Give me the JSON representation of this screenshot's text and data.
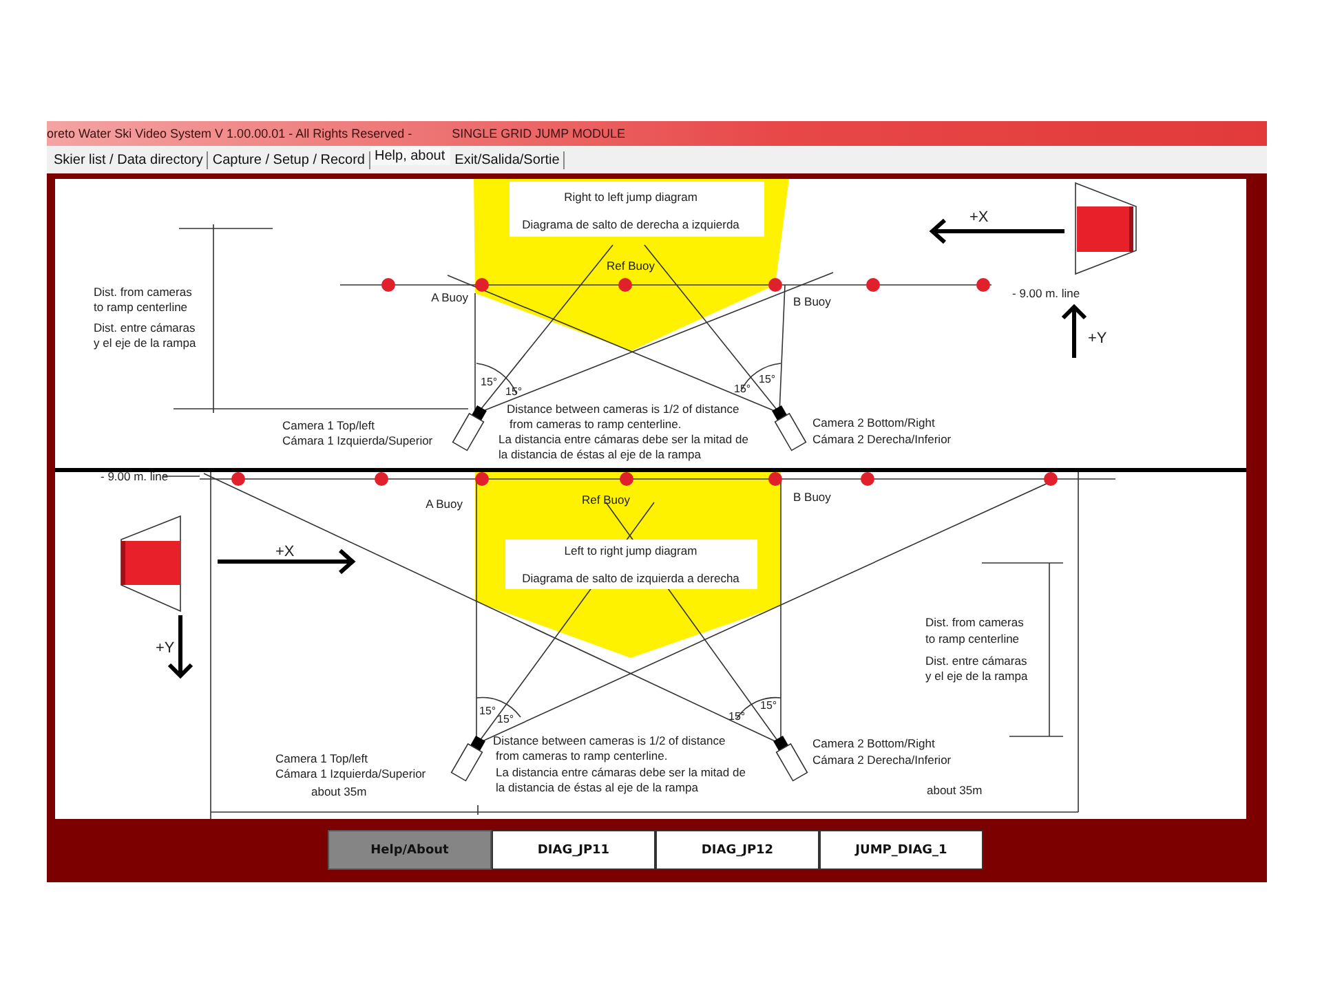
{
  "window": {
    "title": "oreto Water Ski Video System V 1.00.00.01 - All Rights Reserved -",
    "module": "SINGLE GRID JUMP MODULE"
  },
  "tabs": [
    {
      "label": "Skier list / Data directory",
      "selected": false
    },
    {
      "label": "Capture / Setup / Record",
      "selected": false
    },
    {
      "label": "Help, about",
      "selected": true
    },
    {
      "label": "Exit/Salida/Sortie",
      "selected": false
    }
  ],
  "diagrams": [
    {
      "kind": "right_to_left",
      "title": "Right to left jump diagram",
      "subtitle": "Diagrama de salto de derecha a izquierda",
      "ref_buoy": "Ref Buoy",
      "a_buoy": "A Buoy",
      "b_buoy": "B Buoy",
      "line_label": "- 9.00 m. line",
      "x_axis": "+X",
      "y_axis": "+Y",
      "dist": [
        "Dist. from cameras",
        "to ramp centerline",
        "Dist. entre cámaras",
        "y el eje de la rampa"
      ],
      "angles": [
        "15°",
        "15°",
        "15°",
        "15°"
      ],
      "camera1": [
        "Camera 1 Top/left",
        "Cámara 1 Izquierda/Superior"
      ],
      "camera2": [
        "Camera 2 Bottom/Right",
        "Cámara 2 Derecha/Inferior"
      ],
      "note": [
        "Distance between cameras is 1/2 of distance",
        "from cameras to ramp centerline.",
        "La distancia entre cámaras debe ser la mitad de",
        "la distancia de éstas al eje de la rampa"
      ]
    },
    {
      "kind": "left_to_right",
      "title": "Left to right jump diagram",
      "subtitle": "Diagrama de salto de izquierda a derecha",
      "ref_buoy": "Ref Buoy",
      "a_buoy": "A Buoy",
      "b_buoy": "B Buoy",
      "line_label": "- 9.00 m. line",
      "x_axis": "+X",
      "y_axis": "+Y",
      "dist": [
        "Dist. from cameras",
        "to ramp centerline",
        "Dist. entre cámaras",
        "y el eje de la rampa"
      ],
      "angles": [
        "15°",
        "15°",
        "15°",
        "15°"
      ],
      "camera1": [
        "Camera 1 Top/left",
        "Cámara 1 Izquierda/Superior"
      ],
      "camera2": [
        "Camera 2 Bottom/Right",
        "Cámara 2 Derecha/Inferior"
      ],
      "note": [
        "Distance between cameras is 1/2 of distance",
        "from cameras to ramp centerline.",
        "La distancia entre cámaras debe ser la mitad de",
        "la distancia de éstas al eje de la rampa"
      ],
      "spans": [
        "about 35m",
        "about 35m"
      ]
    }
  ],
  "buttons": [
    {
      "label": "Help/About",
      "selected": true
    },
    {
      "label": "DIAG_JP11",
      "selected": false
    },
    {
      "label": "DIAG_JP12",
      "selected": false
    },
    {
      "label": "JUMP_DIAG_1",
      "selected": false
    }
  ]
}
